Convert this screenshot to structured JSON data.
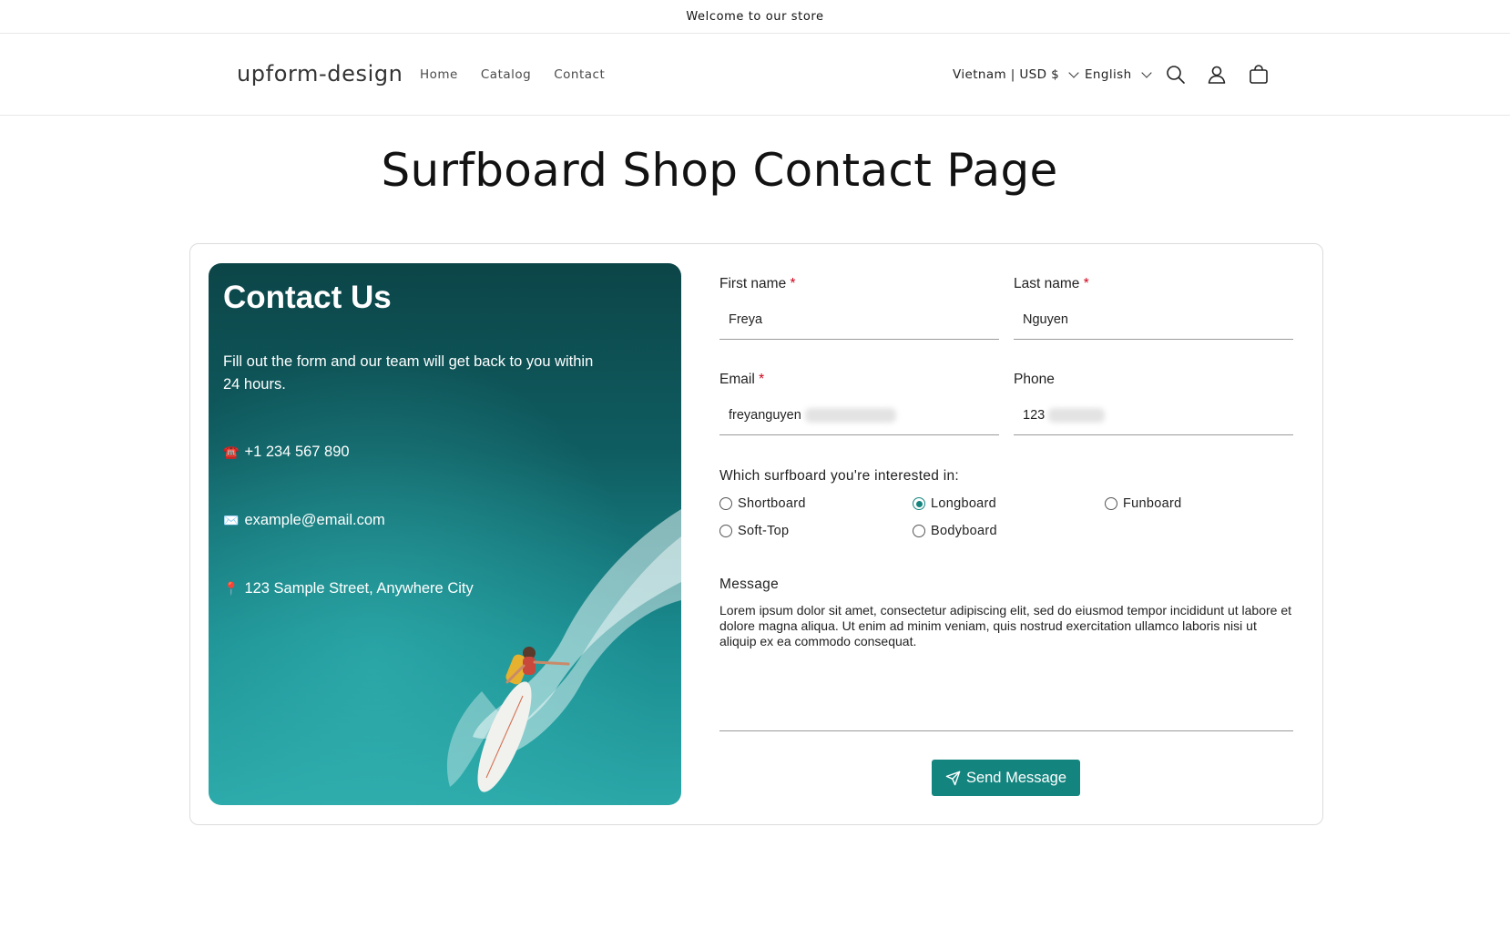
{
  "announcement": "Welcome to our store",
  "header": {
    "logo": "upform-design",
    "nav": [
      "Home",
      "Catalog",
      "Contact"
    ],
    "country": "Vietnam | USD $",
    "language": "English",
    "icons": [
      "search-icon",
      "account-icon",
      "cart-icon"
    ]
  },
  "page": {
    "title": "Surfboard Shop Contact Page"
  },
  "contact_panel": {
    "heading": "Contact Us",
    "intro": "Fill out the form and our team will get back to you within 24 hours.",
    "phone_icon": "☎️",
    "phone": "+1 234 567 890",
    "email_icon": "✉️",
    "email": "example@email.com",
    "address_icon": "📍",
    "address": "123 Sample Street, Anywhere City"
  },
  "form": {
    "first_name": {
      "label": "First name",
      "required": "*",
      "value": "Freya"
    },
    "last_name": {
      "label": "Last name",
      "required": "*",
      "value": "Nguyen"
    },
    "email": {
      "label": "Email",
      "required": "*",
      "value": "freyanguyen"
    },
    "phone": {
      "label": "Phone",
      "value": "123"
    },
    "surfboard_question": "Which surfboard you're interested in:",
    "surfboard_options": [
      "Shortboard",
      "Longboard",
      "Funboard",
      "Soft-Top",
      "Bodyboard"
    ],
    "surfboard_selected": "Longboard",
    "message_label": "Message",
    "message_value": "Lorem ipsum dolor sit amet, consectetur adipiscing elit, sed do eiusmod tempor incididunt ut labore et dolore magna aliqua. Ut enim ad minim veniam, quis nostrud exercitation ullamco laboris nisi ut aliquip ex ea commodo consequat.",
    "submit_label": "Send Message"
  },
  "colors": {
    "accent": "#14847f",
    "required": "#d0021b",
    "ocean": "#1e8c8f"
  }
}
